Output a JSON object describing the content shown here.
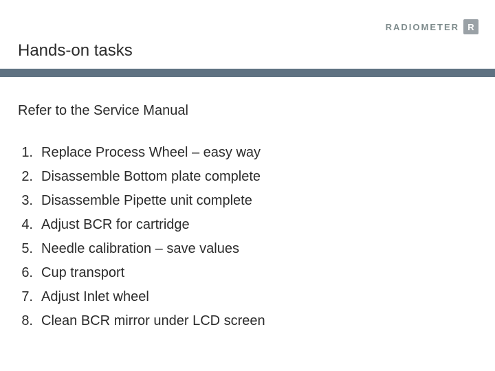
{
  "brand": {
    "name": "RADIOMETER",
    "mark": "R"
  },
  "title": "Hands-on tasks",
  "subtitle": "Refer to the Service Manual",
  "tasks": {
    "n1": "1.",
    "t1": "Replace Process Wheel – easy way",
    "n2": "2.",
    "t2": "Disassemble Bottom plate complete",
    "n3": "3.",
    "t3": "Disassemble Pipette unit complete",
    "n4": "4.",
    "t4": "Adjust BCR for cartridge",
    "n5": "5.",
    "t5": "Needle calibration – save values",
    "n6": "6.",
    "t6": "Cup transport",
    "n7": "7.",
    "t7": "Adjust Inlet wheel",
    "n8": "8.",
    "t8": "Clean BCR mirror under LCD screen"
  }
}
